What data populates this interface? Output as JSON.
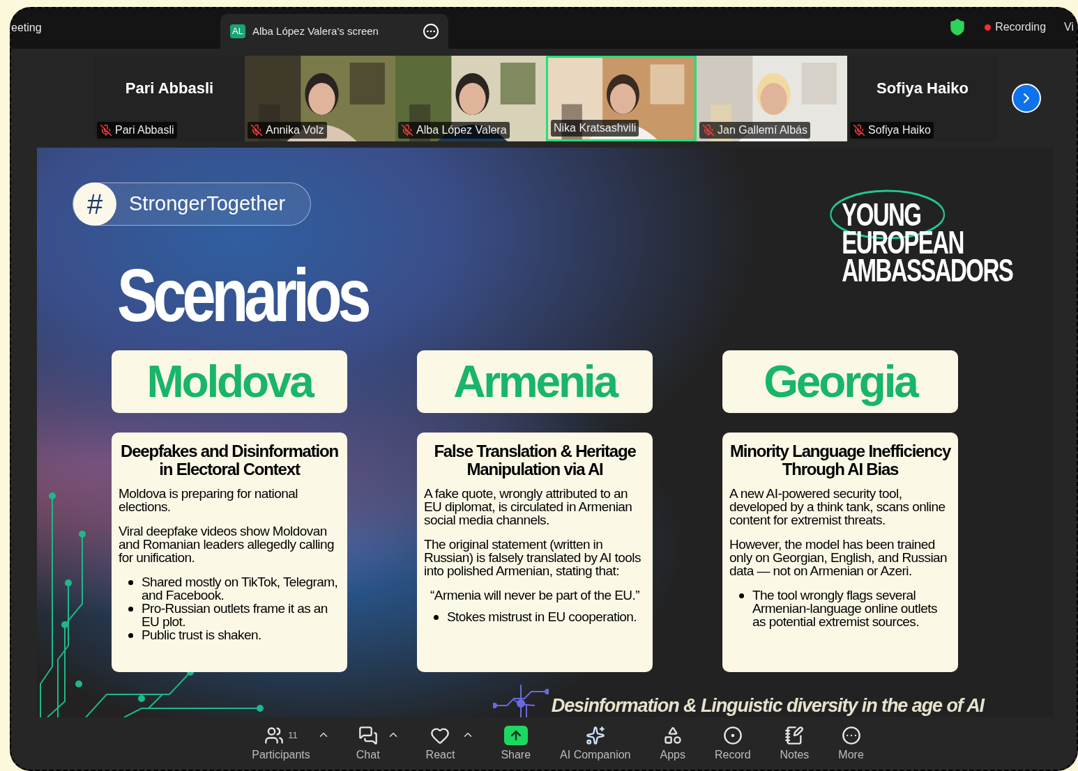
{
  "top_bar": {
    "meeting_title": "eeting",
    "share_tab": {
      "initials": "AL",
      "label": "Alba López Valera's screen"
    },
    "recording": "Recording",
    "view_label": "Vi"
  },
  "participants": [
    {
      "name": "Pari Abbasli",
      "label": "Pari Abbasli",
      "kind": "name",
      "muted": true,
      "speaking": false
    },
    {
      "label": "Annika Volz",
      "kind": "video",
      "muted": true,
      "speaking": false
    },
    {
      "label": "Alba López Valera",
      "kind": "video",
      "muted": true,
      "speaking": false
    },
    {
      "label": "Nika Kratsashvili",
      "kind": "video",
      "muted": false,
      "speaking": true
    },
    {
      "label": "Jan Gallemí Albás",
      "kind": "video",
      "muted": true,
      "speaking": false
    },
    {
      "name": "Sofiya Haiko",
      "label": "Sofiya Haiko",
      "kind": "name",
      "muted": true,
      "speaking": false
    }
  ],
  "slide": {
    "hashtag": {
      "symbol": "#",
      "text": "StrongerTogether"
    },
    "title": "Scenarios",
    "logo": [
      "YOUNG",
      "EUROPEAN",
      "AMBASSADORS"
    ],
    "scenarios": [
      {
        "country": "Moldova",
        "heading": "Deepfakes and Disinformation in Electoral Context",
        "blocks": [
          {
            "kind": "paragraph",
            "text": "Moldova is preparing for national elections."
          },
          {
            "kind": "paragraph",
            "text": "Viral deepfake videos show Moldovan and Romanian leaders allegedly calling for unification."
          },
          {
            "kind": "bullets",
            "items": [
              "Shared mostly on TikTok, Telegram, and Facebook.",
              "Pro-Russian outlets frame it as an EU plot.",
              "Public trust is shaken."
            ]
          }
        ]
      },
      {
        "country": "Armenia",
        "heading": "False Translation & Heritage Manipulation via AI",
        "blocks": [
          {
            "kind": "paragraph",
            "text": "A fake quote, wrongly attributed to an EU diplomat, is circulated in Armenian social media channels."
          },
          {
            "kind": "paragraph",
            "text": "The original statement (written in Russian) is falsely translated by AI tools into polished Armenian, stating that:"
          },
          {
            "kind": "quote",
            "text": "“Armenia will never be part of the EU.”"
          },
          {
            "kind": "bullets",
            "items": [
              "Stokes mistrust in EU cooperation."
            ]
          }
        ]
      },
      {
        "country": "Georgia",
        "heading": "Minority Language Inefficiency Through AI Bias",
        "blocks": [
          {
            "kind": "paragraph",
            "text": "A new AI-powered security tool, developed by a  think tank, scans online content for extremist threats."
          },
          {
            "kind": "paragraph",
            "text": "However, the model has been trained only on Georgian, English, and Russian data — not on Armenian or Azeri."
          },
          {
            "kind": "bullets",
            "items": [
              "The tool wrongly flags several Armenian-language online outlets as potential extremist sources."
            ]
          }
        ]
      }
    ],
    "tagline": "Desinformation & Linguistic diversity in the age of AI"
  },
  "toolbar": [
    {
      "kind": "participants",
      "label": "Participants",
      "count": "11",
      "menu": true
    },
    {
      "kind": "chat",
      "label": "Chat",
      "menu": true
    },
    {
      "kind": "react",
      "label": "React",
      "menu": true
    },
    {
      "kind": "share",
      "label": "Share",
      "menu": false
    },
    {
      "kind": "companion",
      "label": "AI Companion",
      "menu": false
    },
    {
      "kind": "apps",
      "label": "Apps",
      "menu": false
    },
    {
      "kind": "record",
      "label": "Record",
      "menu": false
    },
    {
      "kind": "notes",
      "label": "Notes",
      "menu": false
    },
    {
      "kind": "more",
      "label": "More",
      "menu": false
    }
  ]
}
